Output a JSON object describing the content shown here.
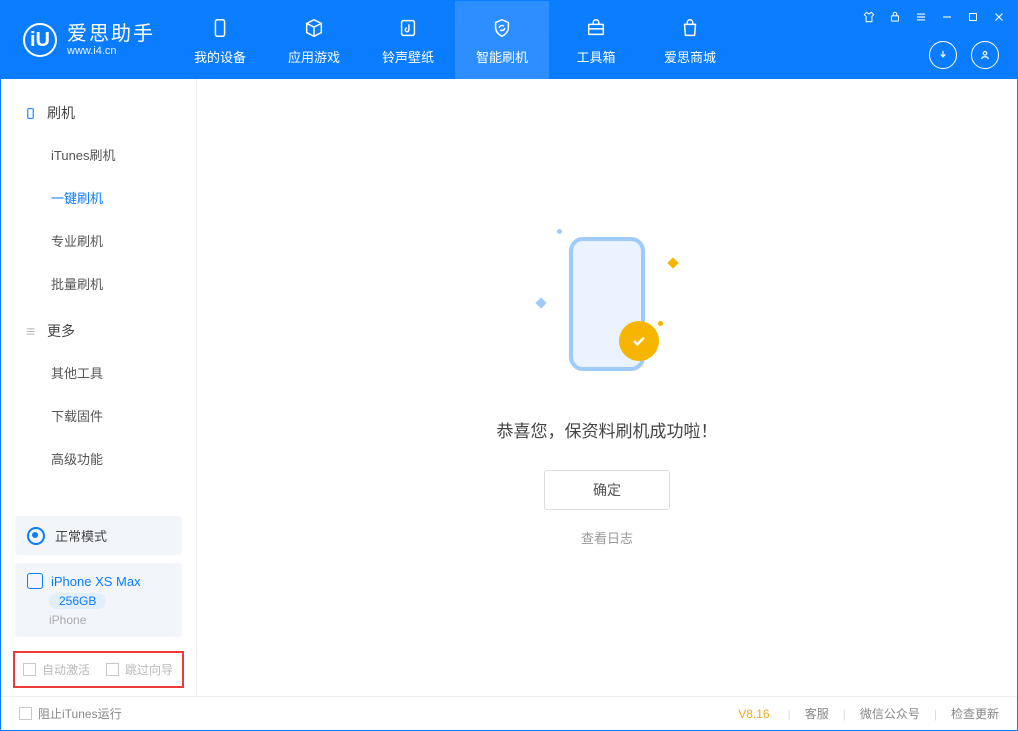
{
  "app": {
    "title": "爱思助手",
    "subtitle": "www.i4.cn"
  },
  "tabs": [
    {
      "label": "我的设备"
    },
    {
      "label": "应用游戏"
    },
    {
      "label": "铃声壁纸"
    },
    {
      "label": "智能刷机"
    },
    {
      "label": "工具箱"
    },
    {
      "label": "爱思商城"
    }
  ],
  "sidebar": {
    "sec1_title": "刷机",
    "items1": [
      "iTunes刷机",
      "一键刷机",
      "专业刷机",
      "批量刷机"
    ],
    "sec2_title": "更多",
    "items2": [
      "其他工具",
      "下载固件",
      "高级功能"
    ]
  },
  "device": {
    "mode": "正常模式",
    "name": "iPhone XS Max",
    "capacity": "256GB",
    "type": "iPhone"
  },
  "options": {
    "auto_activate": "自动激活",
    "skip_guide": "跳过向导"
  },
  "main": {
    "success_title": "恭喜您，保资料刷机成功啦！",
    "ok": "确定",
    "view_log": "查看日志"
  },
  "statusbar": {
    "block_itunes": "阻止iTunes运行",
    "version": "V8.16",
    "support": "客服",
    "wechat": "微信公众号",
    "update": "检查更新"
  }
}
